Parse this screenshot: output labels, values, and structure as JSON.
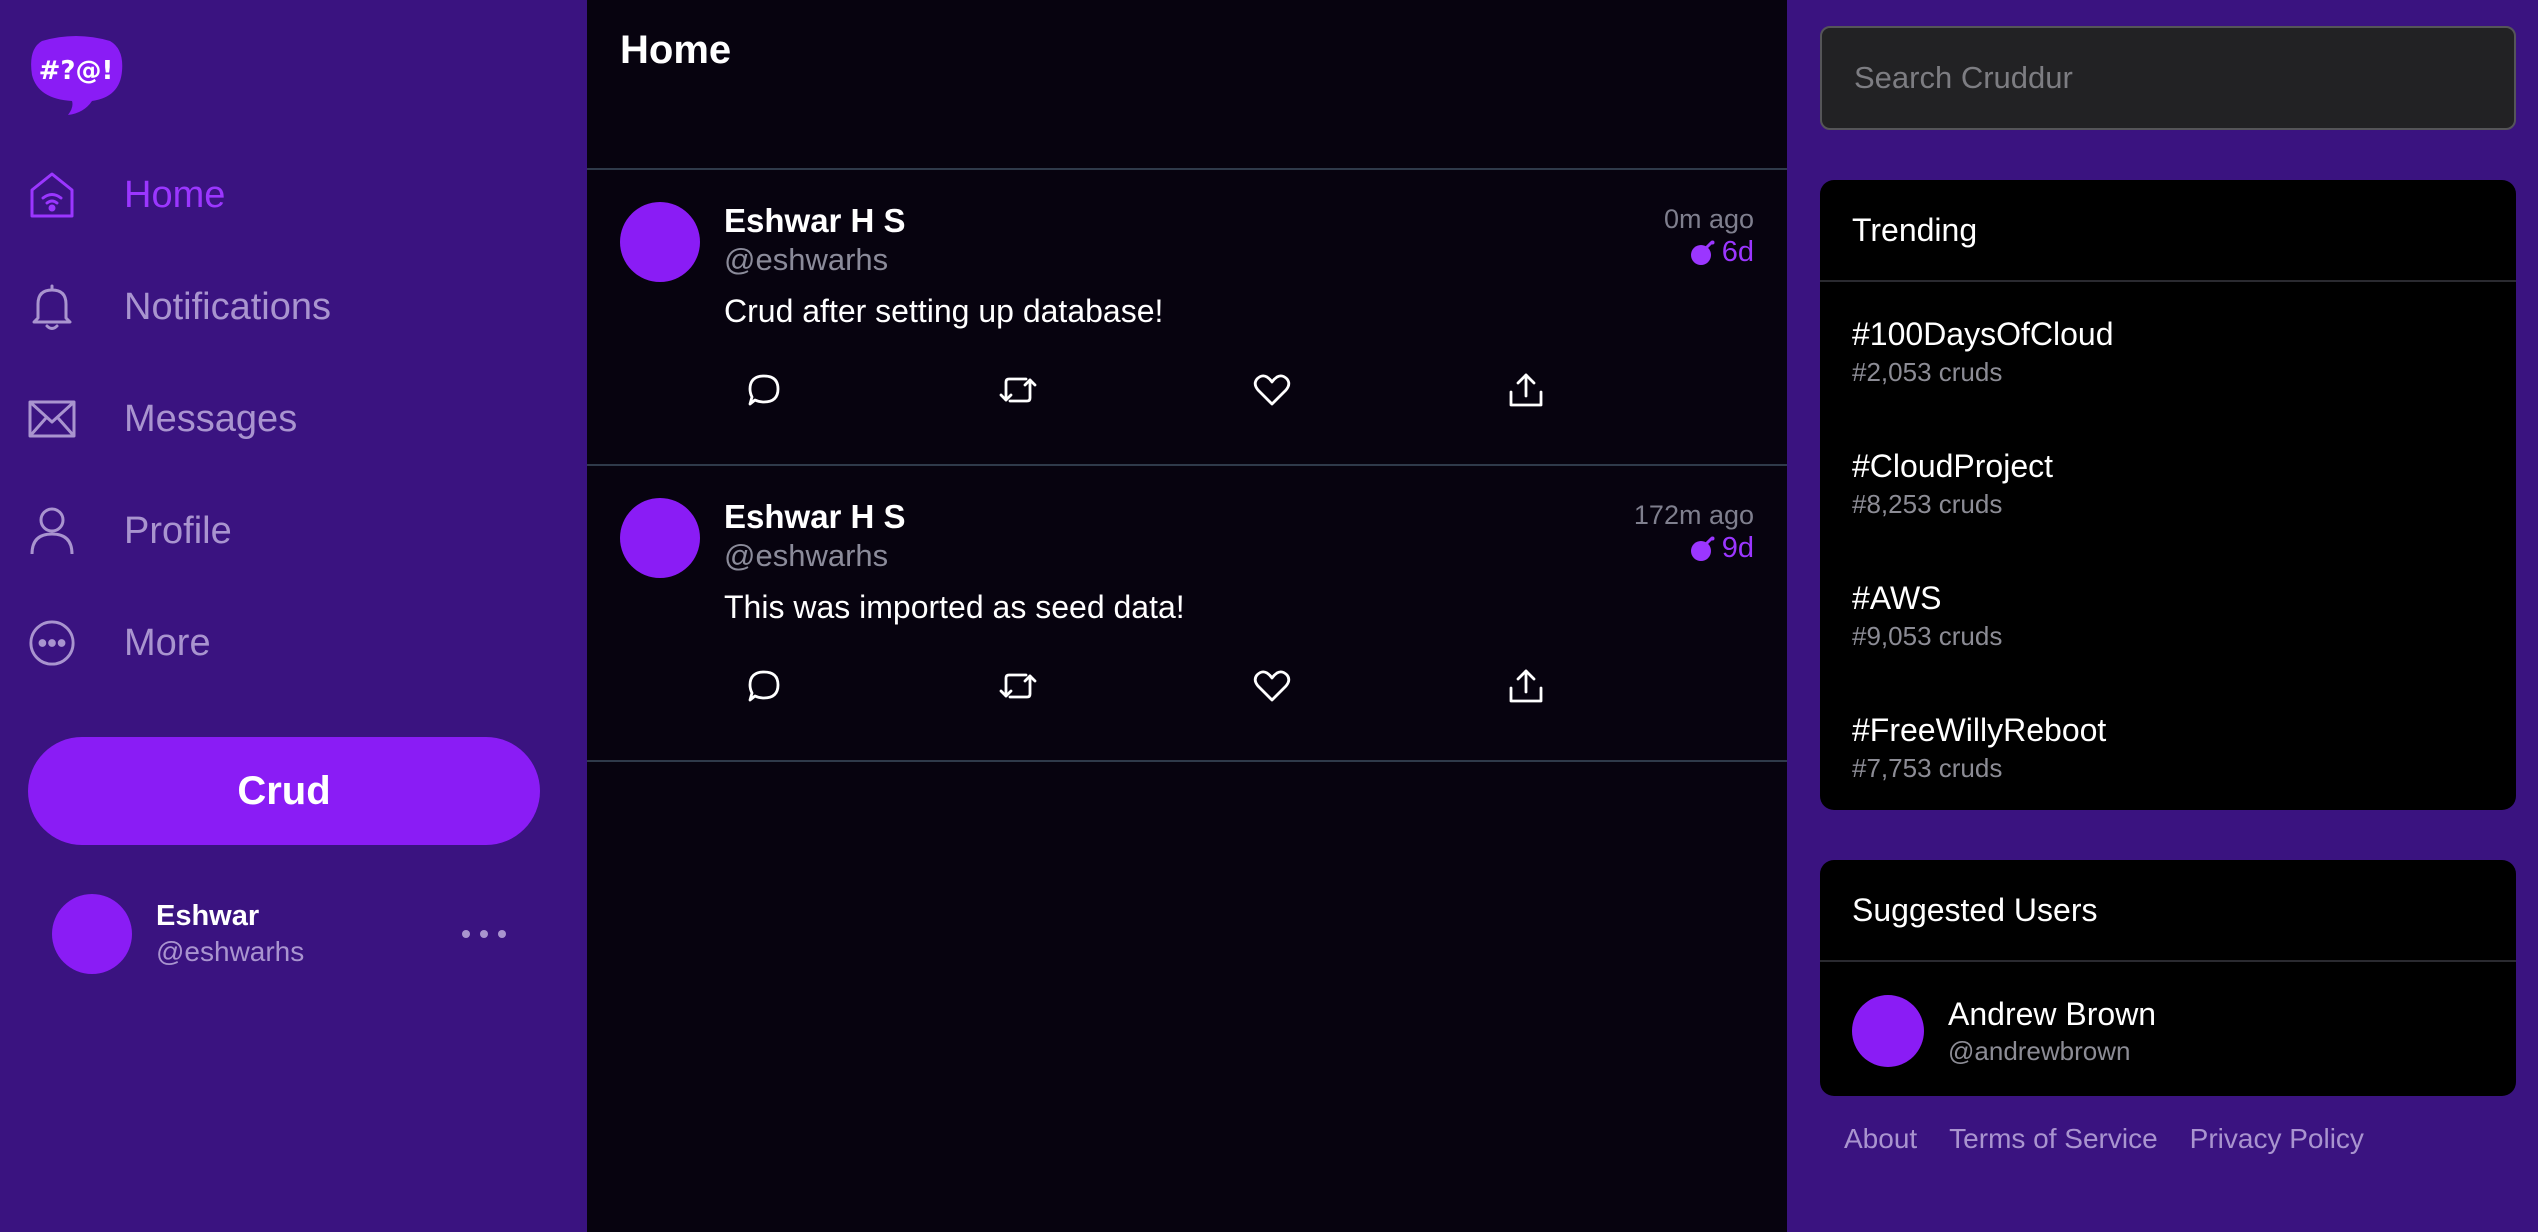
{
  "app": {
    "logo_text": "#?@!",
    "accent_color": "#8a1cf5"
  },
  "sidebar": {
    "items": [
      {
        "label": "Home",
        "icon": "home-icon",
        "active": true
      },
      {
        "label": "Notifications",
        "icon": "bell-icon",
        "active": false
      },
      {
        "label": "Messages",
        "icon": "envelope-icon",
        "active": false
      },
      {
        "label": "Profile",
        "icon": "user-icon",
        "active": false
      },
      {
        "label": "More",
        "icon": "more-circle-icon",
        "active": false
      }
    ],
    "crud_button": "Crud",
    "profile": {
      "name": "Eshwar",
      "handle": "@eshwarhs"
    }
  },
  "main": {
    "title": "Home",
    "posts": [
      {
        "author": "Eshwar H S",
        "handle": "@eshwarhs",
        "ago": "0m ago",
        "expires": "6d",
        "message": "Crud after setting up database!"
      },
      {
        "author": "Eshwar H S",
        "handle": "@eshwarhs",
        "ago": "172m ago",
        "expires": "9d",
        "message": "This was imported as seed data!"
      }
    ]
  },
  "right": {
    "search": {
      "placeholder": "Search Cruddur",
      "value": ""
    },
    "trending": {
      "title": "Trending",
      "items": [
        {
          "tag": "#100DaysOfCloud",
          "count": "#2,053 cruds"
        },
        {
          "tag": "#CloudProject",
          "count": "#8,253 cruds"
        },
        {
          "tag": "#AWS",
          "count": "#9,053 cruds"
        },
        {
          "tag": "#FreeWillyReboot",
          "count": "#7,753 cruds"
        }
      ]
    },
    "suggested": {
      "title": "Suggested Users",
      "users": [
        {
          "name": "Andrew Brown",
          "handle": "@andrewbrown"
        }
      ]
    },
    "footer": {
      "links": [
        "About",
        "Terms of Service",
        "Privacy Policy"
      ]
    }
  }
}
